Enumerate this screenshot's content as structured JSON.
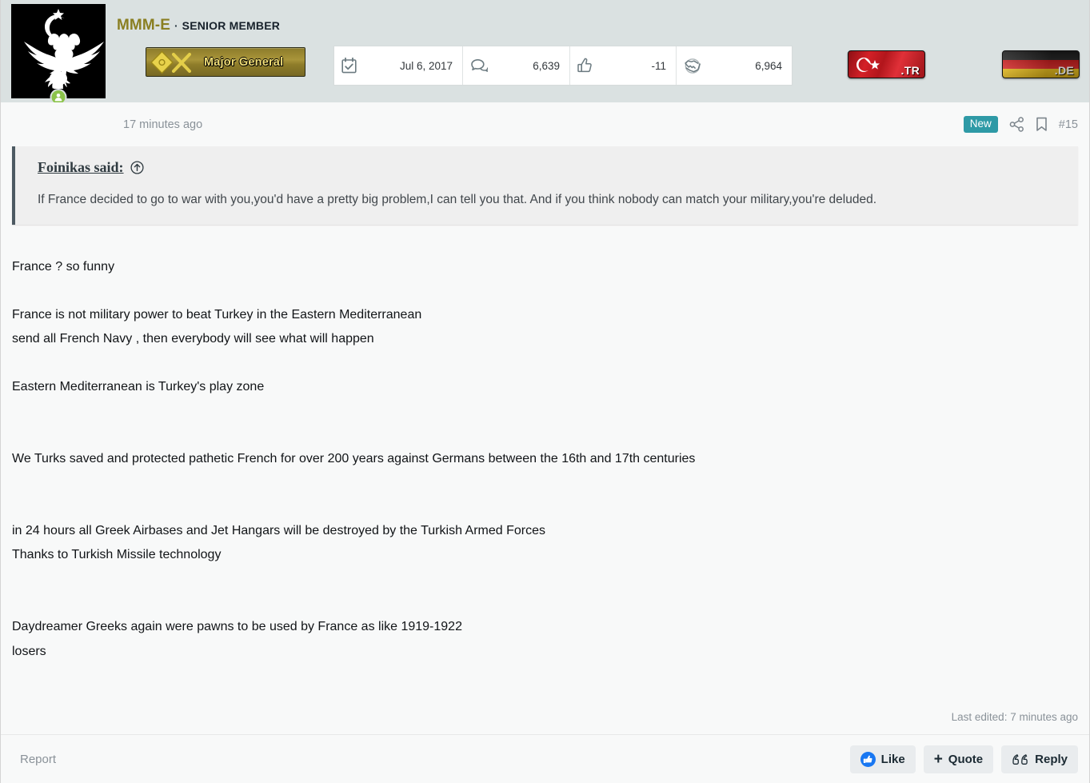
{
  "user": {
    "name": "MMM-E",
    "separator": "·",
    "title": "SENIOR MEMBER",
    "rank_label": "Major General",
    "avatar_alt": "double-headed-eagle-crescent-star",
    "online": true
  },
  "stats": [
    {
      "icon": "calendar-check-icon",
      "label": "Joined",
      "value": "Jul 6, 2017"
    },
    {
      "icon": "messages-icon",
      "label": "Messages",
      "value": "6,639"
    },
    {
      "icon": "thumbs-up-icon",
      "label": "Reaction score",
      "value": "-11"
    },
    {
      "icon": "handshake-icon",
      "label": "Points",
      "value": "6,964"
    }
  ],
  "flags": [
    {
      "icon": "turkey-flag-icon",
      "code": ".TR"
    },
    {
      "icon": "germany-flag-icon",
      "code": ".DE"
    }
  ],
  "meta": {
    "time": "17 minutes ago",
    "badge": "New",
    "share_icon": "share-icon",
    "bookmark_icon": "bookmark-icon",
    "post_number": "#15"
  },
  "quote": {
    "author_said": "Foinikas said:",
    "jump_icon": "jump-to-post-icon",
    "text": "If France decided to go to war with you,you'd have a pretty big problem,I can tell you that. And if you think nobody can match your military,you're deluded."
  },
  "message": {
    "p1": "France ? so funny",
    "p2_l1": "France is not military power to beat Turkey in the Eastern Mediterranean",
    "p2_l2": "send all French Navy , then everybody will see what will happen",
    "p3": "Eastern Mediterranean is Turkey's play zone",
    "p4": "We Turks saved and protected pathetic French for over 200 years against Germans between the 16th and 17th centuries",
    "p5_l1": "in 24 hours all Greek Airbases and Jet Hangars will be destroyed by the Turkish Armed Forces",
    "p5_l2": "Thanks to Turkish Missile technology",
    "p6_l1": "Daydreamer Greeks again were pawns to be used by France as like 1919-1922",
    "p6_l2": "losers"
  },
  "last_edited": "Last edited: 7 minutes ago",
  "footer": {
    "report": "Report",
    "like": "Like",
    "quote": "Quote",
    "quote_plus": "+",
    "reply": "Reply"
  },
  "colors": {
    "header_bg": "#dae1e1",
    "body_bg": "#f8f9f9",
    "username": "#8a7f22",
    "badge_new": "#2e9aa6",
    "quote_bg": "#efefef",
    "quote_border": "#4d5a62",
    "like_blue": "#1877f2"
  }
}
